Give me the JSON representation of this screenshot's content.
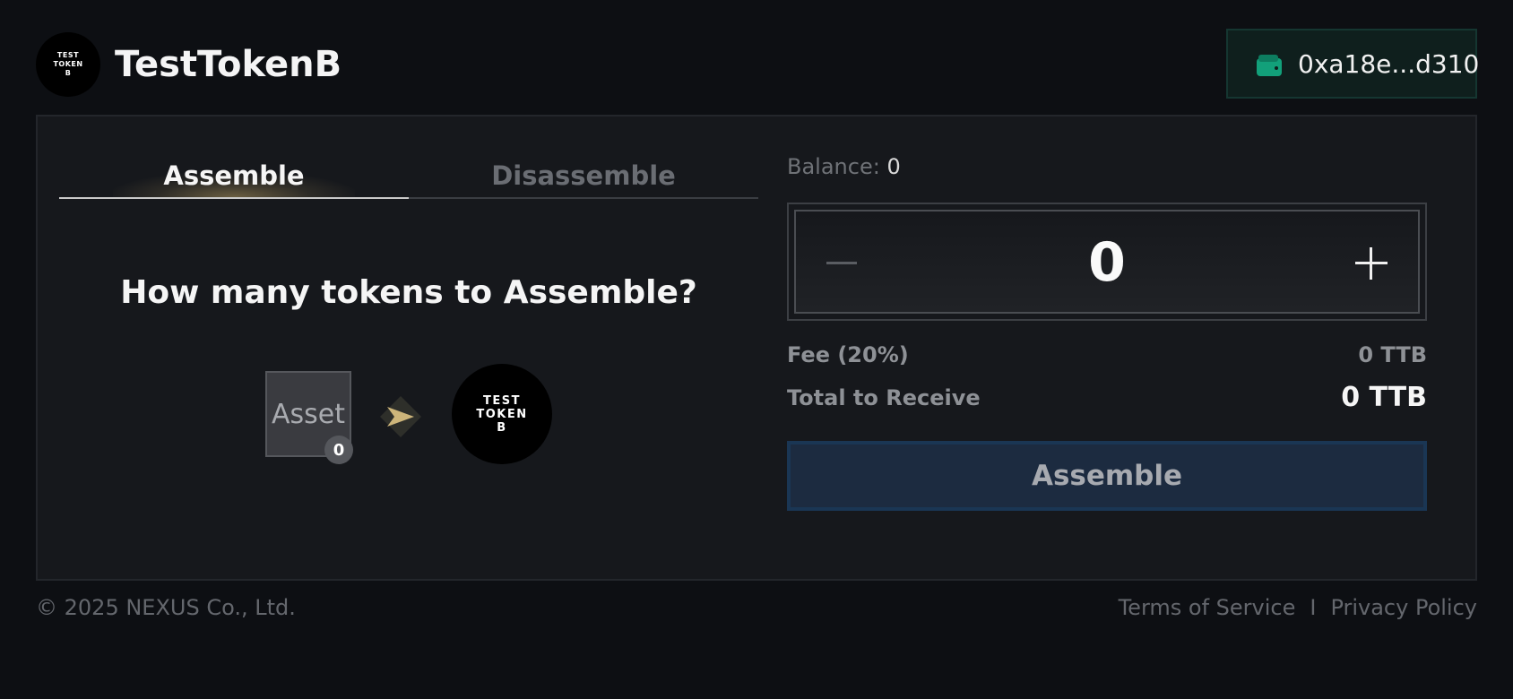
{
  "header": {
    "logo_lines": [
      "TEST",
      "TOKEN",
      "B"
    ],
    "title": "TestTokenB",
    "wallet_address": "0xa18e...d310",
    "wallet_icon": "wallet-icon"
  },
  "tabs": [
    {
      "label": "Assemble",
      "active": true
    },
    {
      "label": "Disassemble",
      "active": false
    }
  ],
  "left": {
    "question": "How many tokens to Assemble?",
    "asset_label": "Asset",
    "asset_count": "0",
    "token_lines": [
      "TEST",
      "TOKEN",
      "B"
    ]
  },
  "right": {
    "balance_label": "Balance:",
    "balance_value": "0",
    "amount": "0",
    "fee_label": "Fee (20%)",
    "fee_value": "0 TTB",
    "total_label": "Total to Receive",
    "total_value": "0 TTB",
    "submit_label": "Assemble"
  },
  "footer": {
    "copyright": "© 2025 NEXUS Co., Ltd.",
    "terms": "Terms of Service",
    "separator": "I",
    "privacy": "Privacy Policy"
  },
  "colors": {
    "background": "#0d0f13",
    "panel": "#16181c",
    "wallet_accent": "#12a07a",
    "tab_glow": "#d2b46e",
    "button": "#1c2b40"
  }
}
